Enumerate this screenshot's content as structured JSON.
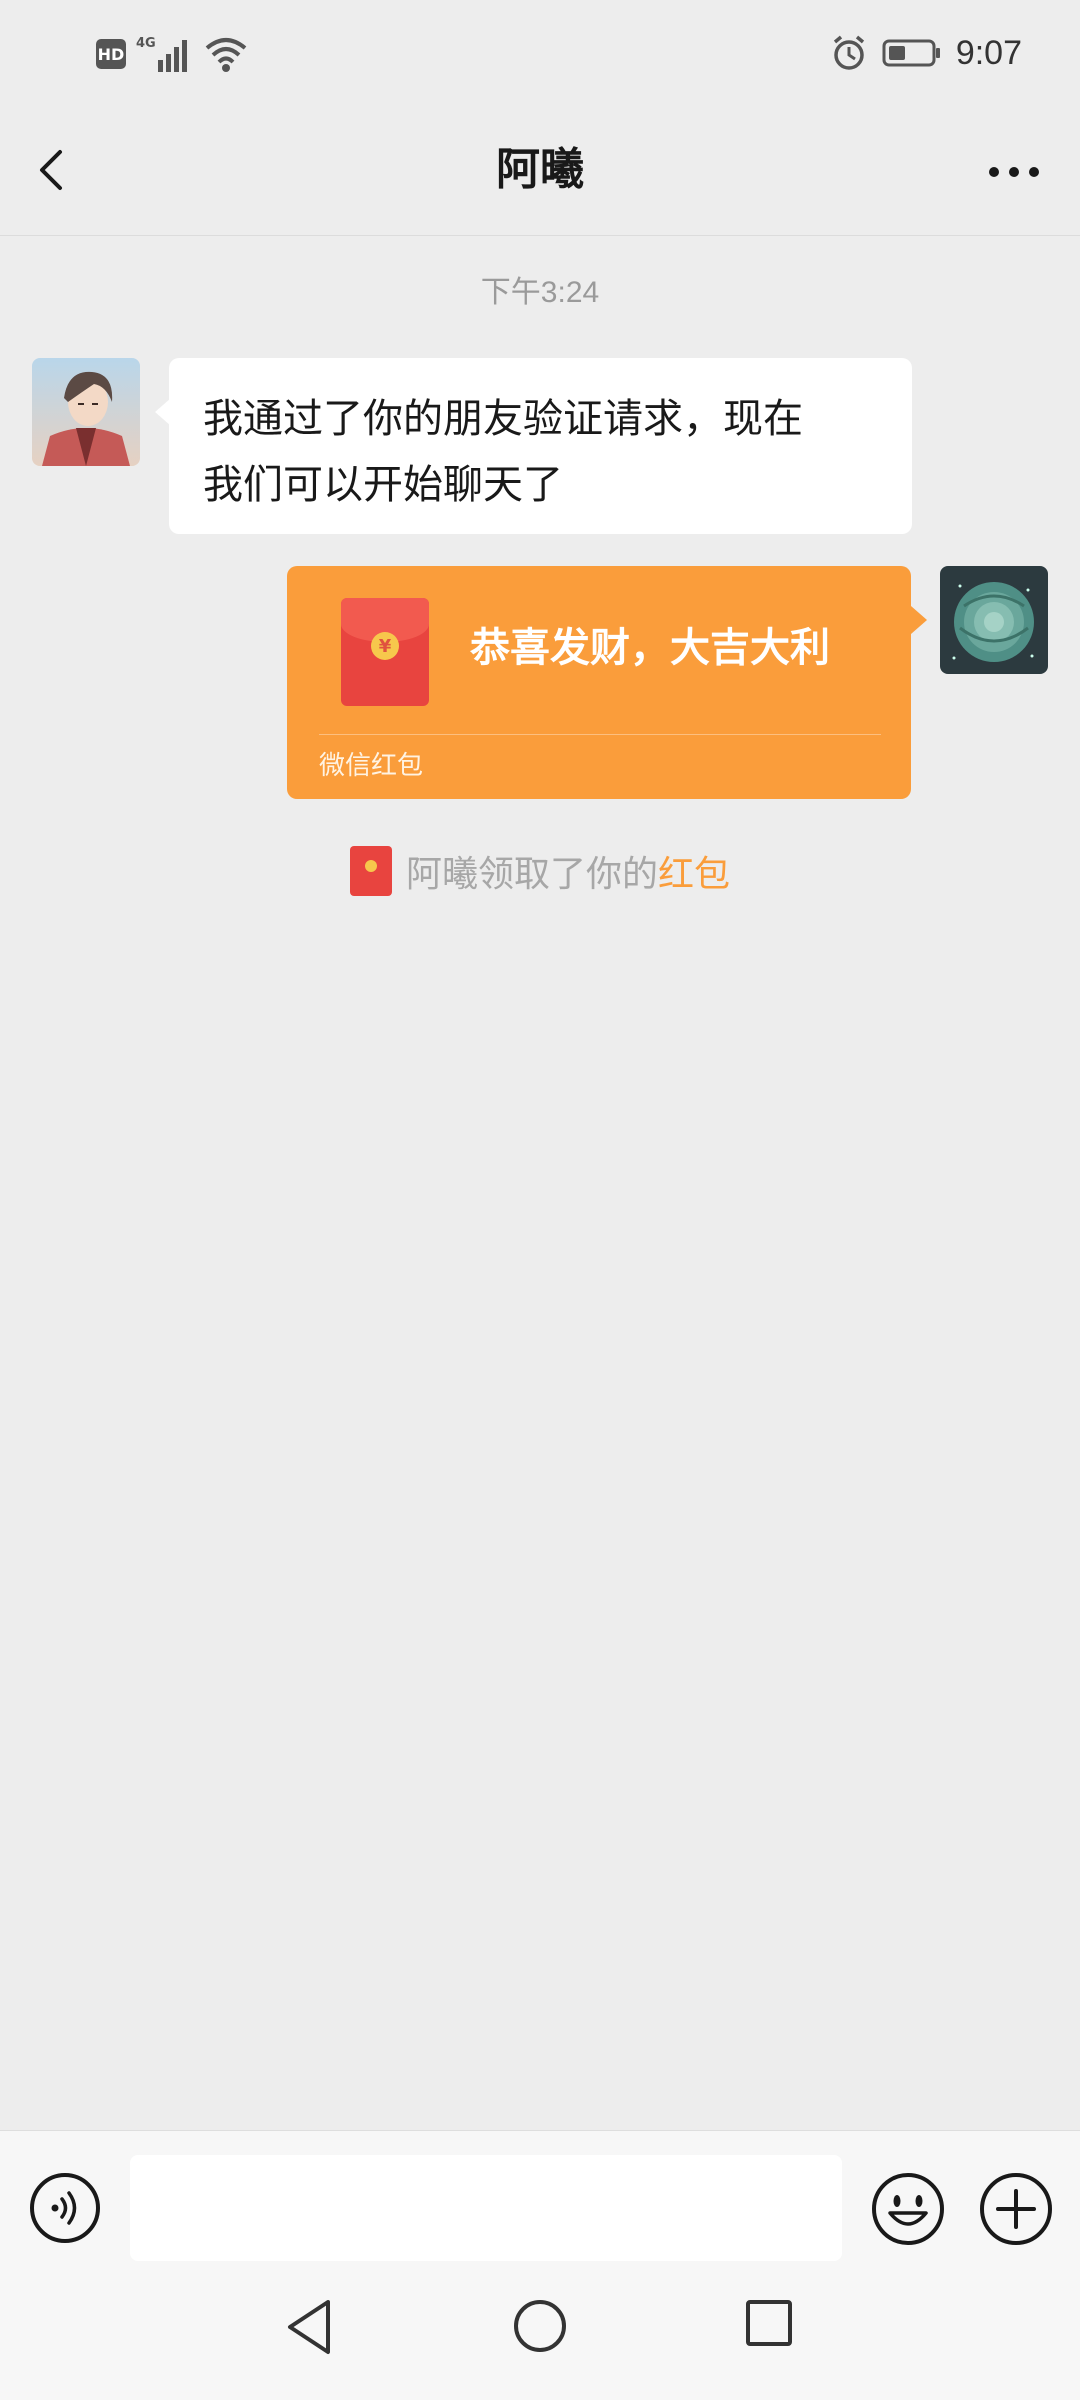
{
  "status_bar": {
    "hd_label": "HD",
    "network_label": "4G",
    "time": "9:07"
  },
  "header": {
    "title": "阿曦"
  },
  "chat": {
    "timestamp": "下午3:24",
    "messages": [
      {
        "sender": "friend",
        "text_line1": "我通过了你的朋友验证请求，现在",
        "text_line2": "我们可以开始聊天了"
      },
      {
        "sender": "me",
        "type": "red_packet",
        "greeting": "恭喜发财，大吉大利",
        "footer": "微信红包",
        "coin_symbol": "¥"
      }
    ],
    "system_notice": {
      "prefix": "阿曦领取了你的",
      "link": "红包"
    }
  },
  "input_bar": {
    "text_value": "",
    "placeholder": ""
  },
  "colors": {
    "background": "#ededed",
    "red_packet": "#fa9d3b",
    "packet_icon": "#e8443f",
    "link": "#fa9d3b"
  },
  "icons": {
    "back": "chevron-left-icon",
    "more": "more-dots-icon",
    "voice": "voice-icon",
    "emoji": "emoji-icon",
    "plus": "plus-icon"
  }
}
